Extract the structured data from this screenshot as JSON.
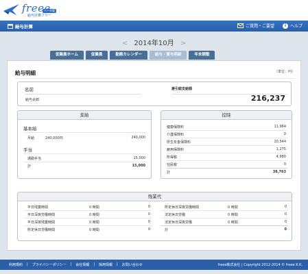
{
  "brand": {
    "word": "freee",
    "beta": "ベータ版",
    "sub": "給与計算フリー"
  },
  "nav": {
    "app_title": "給与計算",
    "faq": "ご質問・ご要望",
    "help": "ヘルプ"
  },
  "period": {
    "label": "2014年10月",
    "prev": "<",
    "next": ">"
  },
  "tabs": [
    {
      "label": "従業員ホーム"
    },
    {
      "label": "従業員"
    },
    {
      "label": "勤務カレンダー"
    },
    {
      "label": "給与・賞与明細"
    },
    {
      "label": "年末調整"
    }
  ],
  "payslip": {
    "title": "給与明細",
    "unit": "（単位：円）",
    "name_label": "名前",
    "employee": "給与太郎",
    "net_label": "差引総支給額",
    "net_value": "216,237"
  },
  "payments": {
    "header": "支給",
    "base_section": "基本給",
    "monthly_label": "月給",
    "monthly_rate": "240,000円",
    "monthly_value": "240,000",
    "allowance_section": "手当",
    "commute_label": "通勤手当",
    "commute_value": "15,000",
    "total_label": "計",
    "total_value": "15,000"
  },
  "deductions": {
    "header": "控除",
    "rows": [
      {
        "label": "健康保険料",
        "value": "11,964"
      },
      {
        "label": "介護保険料",
        "value": "0"
      },
      {
        "label": "厚生年金保険料",
        "value": "20,544"
      },
      {
        "label": "雇用保険料",
        "value": "1,275"
      },
      {
        "label": "所得税",
        "value": "4,980"
      },
      {
        "label": "住民税",
        "value": "0"
      }
    ],
    "total_label": "計",
    "total_value": "38,763"
  },
  "overtime": {
    "header": "残業代",
    "left": [
      {
        "label": "平日残業時間",
        "time": "0 時間",
        "value": "0"
      },
      {
        "label": "平日深夜労働時間",
        "time": "0 時間",
        "value": "0"
      },
      {
        "label": "平日深夜残業時間",
        "time": "0 時間",
        "value": "0"
      },
      {
        "label": "所定休日労働時間",
        "time": "0 時間",
        "value": "0"
      }
    ],
    "right": [
      {
        "label": "所定休日深夜労働時間",
        "time": "0 時間",
        "value": "0"
      },
      {
        "label": "法定休日労働",
        "time": "0 時間",
        "value": "0"
      },
      {
        "label": "法定休日深夜労働",
        "time": "0 時間",
        "value": "0"
      }
    ],
    "total_label": "計",
    "total_value": "0"
  },
  "footer": {
    "links": [
      "利用規約",
      "プライバシーポリシー",
      "会社情報",
      "採用情報",
      "お問い合わせ"
    ],
    "copyright": "freee株式会社 | Copyright 2012-2014 © freee K.K."
  },
  "colors": {
    "brand_blue": "#2a5fa8",
    "tab": "#4a6f94",
    "tab_active": "#a9bcd2"
  }
}
